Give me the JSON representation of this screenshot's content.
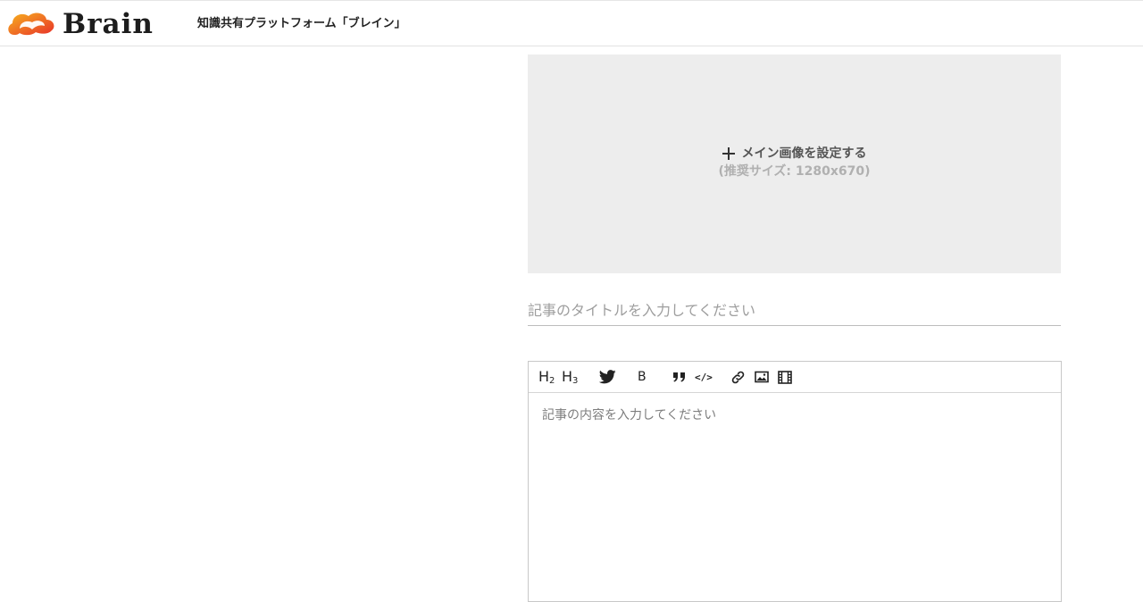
{
  "header": {
    "logo_text": "Brain",
    "tagline": "知識共有プラットフォーム「ブレイン」"
  },
  "main_image": {
    "label": "メイン画像を設定する",
    "hint": "(推奨サイズ: 1280x670)"
  },
  "title_field": {
    "value": "",
    "placeholder": "記事のタイトルを入力してください"
  },
  "editor": {
    "toolbar": {
      "h2": "H",
      "h2_sub": "2",
      "h3": "H",
      "h3_sub": "3",
      "bold": "B",
      "quote": "❞",
      "code": "</>"
    },
    "toolbar_icons": [
      "h2-icon",
      "h3-icon",
      "twitter-icon",
      "bold-icon",
      "quote-icon",
      "code-icon",
      "link-icon",
      "image-icon",
      "video-icon"
    ],
    "content_value": "",
    "content_placeholder": "記事の内容を入力してください"
  },
  "colors": {
    "image_placeholder_bg": "#ededed",
    "logo_red": "#e8322a",
    "logo_orange": "#f29a1f"
  }
}
